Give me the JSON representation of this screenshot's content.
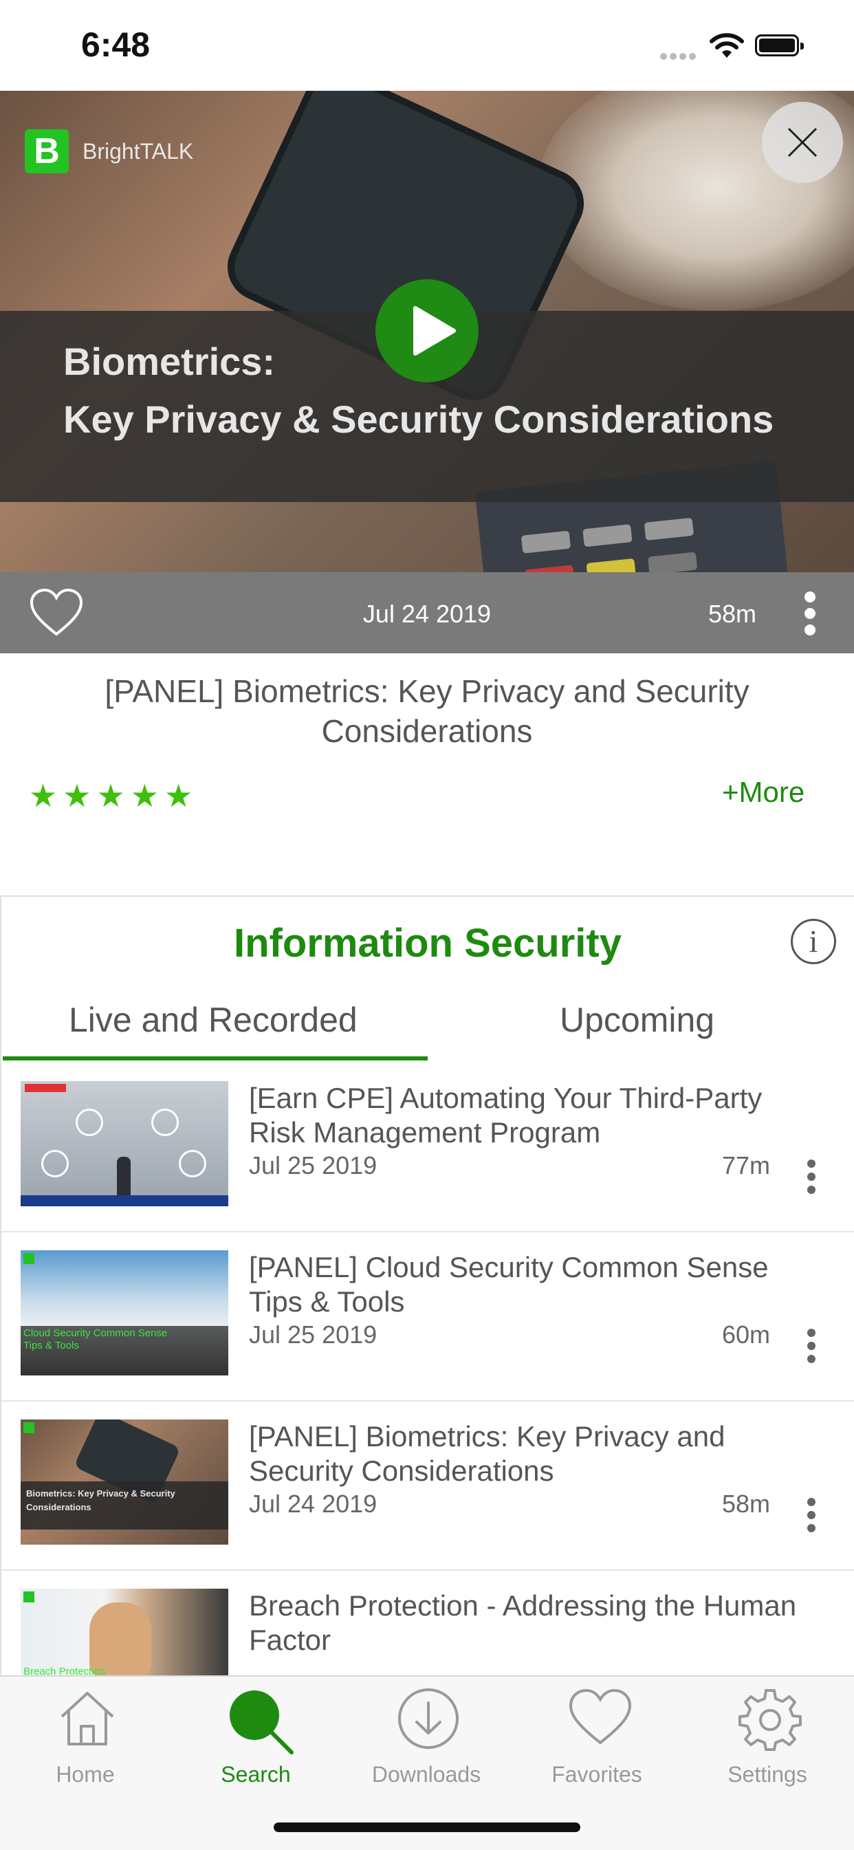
{
  "status_bar": {
    "time": "6:48"
  },
  "hero": {
    "brand": "BrightTALK",
    "title_line1": "Biometrics:",
    "title_line2": "Key Privacy & Security Considerations"
  },
  "meta": {
    "date": "Jul 24 2019",
    "duration": "58m"
  },
  "video": {
    "title": "[PANEL] Biometrics: Key Privacy and Security Considerations",
    "rating": 5,
    "more_label": "+More"
  },
  "channel": {
    "title": "Information Security",
    "info_label": "i",
    "tabs": [
      {
        "label": "Live and Recorded",
        "active": true
      },
      {
        "label": "Upcoming",
        "active": false
      }
    ]
  },
  "list": [
    {
      "title": "[Earn CPE] Automating Your Third-Party Risk Management Program",
      "date": "Jul 25 2019",
      "duration": "77m",
      "thumb_text": ""
    },
    {
      "title": "[PANEL] Cloud Security Common Sense Tips & Tools",
      "date": "Jul 25 2019",
      "duration": "60m",
      "thumb_text": "Cloud Security Common Sense Tips & Tools"
    },
    {
      "title": "[PANEL] Biometrics: Key Privacy and Security Considerations",
      "date": "Jul 24 2019",
      "duration": "58m",
      "thumb_text": "Biometrics: Key Privacy & Security Considerations"
    },
    {
      "title": "Breach Protection - Addressing the Human Factor",
      "date": "",
      "duration": "",
      "thumb_text": "Breach Protection"
    }
  ],
  "tabbar": [
    {
      "label": "Home",
      "icon": "home-icon",
      "active": false
    },
    {
      "label": "Search",
      "icon": "search-icon",
      "active": true
    },
    {
      "label": "Downloads",
      "icon": "download-icon",
      "active": false
    },
    {
      "label": "Favorites",
      "icon": "heart-icon",
      "active": false
    },
    {
      "label": "Settings",
      "icon": "gear-icon",
      "active": false
    }
  ],
  "colors": {
    "accent": "#1e8a10",
    "star": "#3fbf0c",
    "meta_bar": "#7a7a7a"
  }
}
